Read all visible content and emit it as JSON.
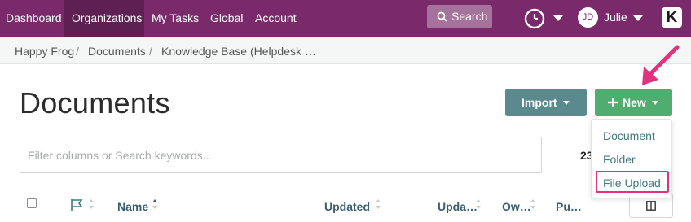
{
  "topnav": {
    "items": [
      {
        "label": "Dashboard",
        "active": false
      },
      {
        "label": "Organizations",
        "active": true
      },
      {
        "label": "My Tasks",
        "active": false
      },
      {
        "label": "Global",
        "active": false
      },
      {
        "label": "Account",
        "active": false
      }
    ],
    "search_label": "Search",
    "user_initials": "JD",
    "user_name": "Julie",
    "logo_text": "K",
    "bg_color": "#7a2a6b"
  },
  "breadcrumb": {
    "items": [
      "Happy Frog",
      "Documents",
      "Knowledge Base (Helpdesk …"
    ],
    "separator": "/"
  },
  "page": {
    "title": "Documents",
    "import_label": "Import",
    "new_label": "New",
    "filter_placeholder": "Filter columns or Search keywords...",
    "count_text": "23"
  },
  "new_menu": {
    "items": [
      "Document",
      "Folder",
      "File Upload"
    ],
    "highlighted": "File Upload"
  },
  "table": {
    "headers": [
      "Name",
      "Updated",
      "Upda…",
      "Ow…",
      "Pu…"
    ]
  },
  "colors": {
    "import_button": "#5a8a8e",
    "new_button": "#4fae6f",
    "annotation": "#e3307f"
  }
}
